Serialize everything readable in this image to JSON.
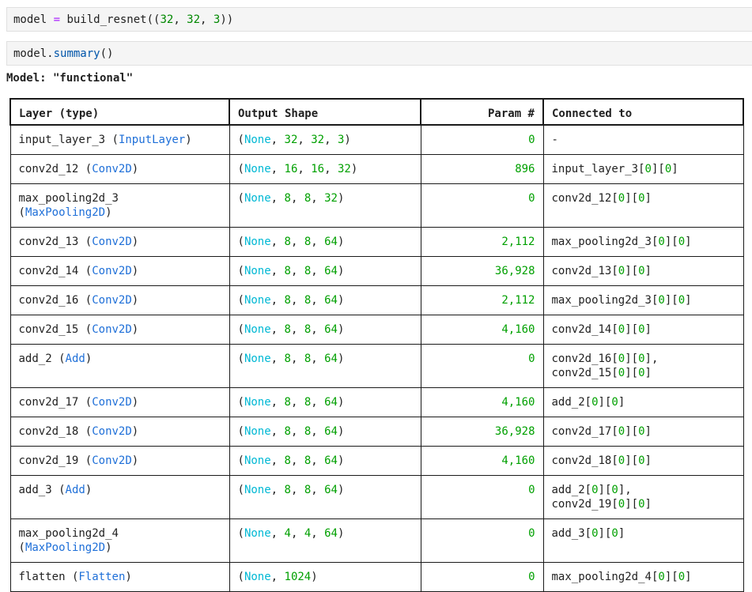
{
  "cells": [
    {
      "code": "model = build_resnet((32, 32, 3))"
    },
    {
      "code": "model.summary()"
    }
  ],
  "model_title": "Model: \"functional\"",
  "table": {
    "headers": [
      "Layer (type)",
      "Output Shape",
      "Param #",
      "Connected to"
    ],
    "rows": [
      {
        "name": "input_layer_3",
        "type": "InputLayer",
        "shape": [
          "None",
          "32",
          "32",
          "3"
        ],
        "param": "0",
        "connected": [
          "-"
        ]
      },
      {
        "name": "conv2d_12",
        "type": "Conv2D",
        "shape": [
          "None",
          "16",
          "16",
          "32"
        ],
        "param": "896",
        "connected": [
          "input_layer_3[0][0]"
        ]
      },
      {
        "name": "max_pooling2d_3",
        "type": "MaxPooling2D",
        "wrap": true,
        "shape": [
          "None",
          "8",
          "8",
          "32"
        ],
        "param": "0",
        "connected": [
          "conv2d_12[0][0]"
        ]
      },
      {
        "name": "conv2d_13",
        "type": "Conv2D",
        "shape": [
          "None",
          "8",
          "8",
          "64"
        ],
        "param": "2,112",
        "connected": [
          "max_pooling2d_3[0][0]"
        ]
      },
      {
        "name": "conv2d_14",
        "type": "Conv2D",
        "shape": [
          "None",
          "8",
          "8",
          "64"
        ],
        "param": "36,928",
        "connected": [
          "conv2d_13[0][0]"
        ]
      },
      {
        "name": "conv2d_16",
        "type": "Conv2D",
        "shape": [
          "None",
          "8",
          "8",
          "64"
        ],
        "param": "2,112",
        "connected": [
          "max_pooling2d_3[0][0]"
        ]
      },
      {
        "name": "conv2d_15",
        "type": "Conv2D",
        "shape": [
          "None",
          "8",
          "8",
          "64"
        ],
        "param": "4,160",
        "connected": [
          "conv2d_14[0][0]"
        ]
      },
      {
        "name": "add_2",
        "type": "Add",
        "shape": [
          "None",
          "8",
          "8",
          "64"
        ],
        "param": "0",
        "connected": [
          "conv2d_16[0][0],",
          "conv2d_15[0][0]"
        ]
      },
      {
        "name": "conv2d_17",
        "type": "Conv2D",
        "shape": [
          "None",
          "8",
          "8",
          "64"
        ],
        "param": "4,160",
        "connected": [
          "add_2[0][0]"
        ]
      },
      {
        "name": "conv2d_18",
        "type": "Conv2D",
        "shape": [
          "None",
          "8",
          "8",
          "64"
        ],
        "param": "36,928",
        "connected": [
          "conv2d_17[0][0]"
        ]
      },
      {
        "name": "conv2d_19",
        "type": "Conv2D",
        "shape": [
          "None",
          "8",
          "8",
          "64"
        ],
        "param": "4,160",
        "connected": [
          "conv2d_18[0][0]"
        ]
      },
      {
        "name": "add_3",
        "type": "Add",
        "shape": [
          "None",
          "8",
          "8",
          "64"
        ],
        "param": "0",
        "connected": [
          "add_2[0][0],",
          "conv2d_19[0][0]"
        ]
      },
      {
        "name": "max_pooling2d_4",
        "type": "MaxPooling2D",
        "wrap": true,
        "shape": [
          "None",
          "4",
          "4",
          "64"
        ],
        "param": "0",
        "connected": [
          "add_3[0][0]"
        ]
      },
      {
        "name": "flatten",
        "type": "Flatten",
        "shape": [
          "None",
          "1024"
        ],
        "param": "0",
        "connected": [
          "max_pooling2d_4[0][0]"
        ]
      }
    ]
  },
  "colors": {
    "none_token": "#00b8d4",
    "number_token": "#00a000",
    "class_token": "#1e6fd8",
    "operator_token": "#aa22ff",
    "cell_background": "#f5f5f5"
  }
}
